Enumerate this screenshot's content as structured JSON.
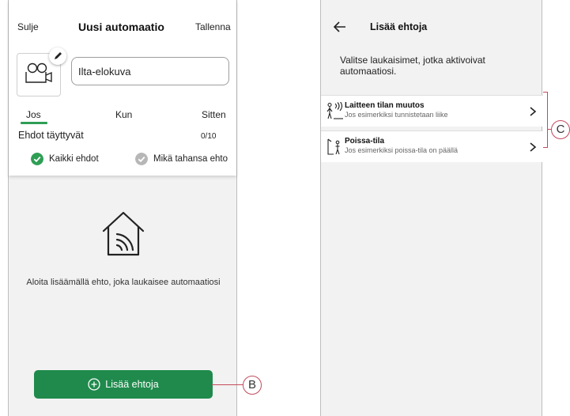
{
  "left_screen": {
    "close_label": "Sulje",
    "title": "Uusi automaatio",
    "save_label": "Tallenna",
    "name_value": "Ilta-elokuva",
    "tabs": [
      {
        "label": "Jos",
        "active": true
      },
      {
        "label": "Kun",
        "active": false
      },
      {
        "label": "Sitten",
        "active": false
      }
    ],
    "conditions_label": "Ehdot täyttyvät",
    "conditions_count": "0/10",
    "options": [
      {
        "label": "Kaikki ehdot",
        "selected": true
      },
      {
        "label": "Mikä tahansa ehto",
        "selected": false
      }
    ],
    "empty_text": "Aloita lisäämällä ehto, joka laukaisee automaatiosi",
    "add_button_label": "Lisää ehtoja",
    "accent_color": "#1f8a4c"
  },
  "right_screen": {
    "title": "Lisää ehtoja",
    "description": "Valitse laukaisimet, jotka aktivoivat automaatiosi.",
    "triggers": [
      {
        "title": "Laitteen tilan muutos",
        "subtitle": "Jos esimerkiksi tunnistetaan liike",
        "icon": "person-motion-icon"
      },
      {
        "title": "Poissa-tila",
        "subtitle": "Jos esimerkiksi poissa-tila on päällä",
        "icon": "away-mode-icon"
      }
    ]
  },
  "callouts": {
    "b": "B",
    "c": "C"
  }
}
